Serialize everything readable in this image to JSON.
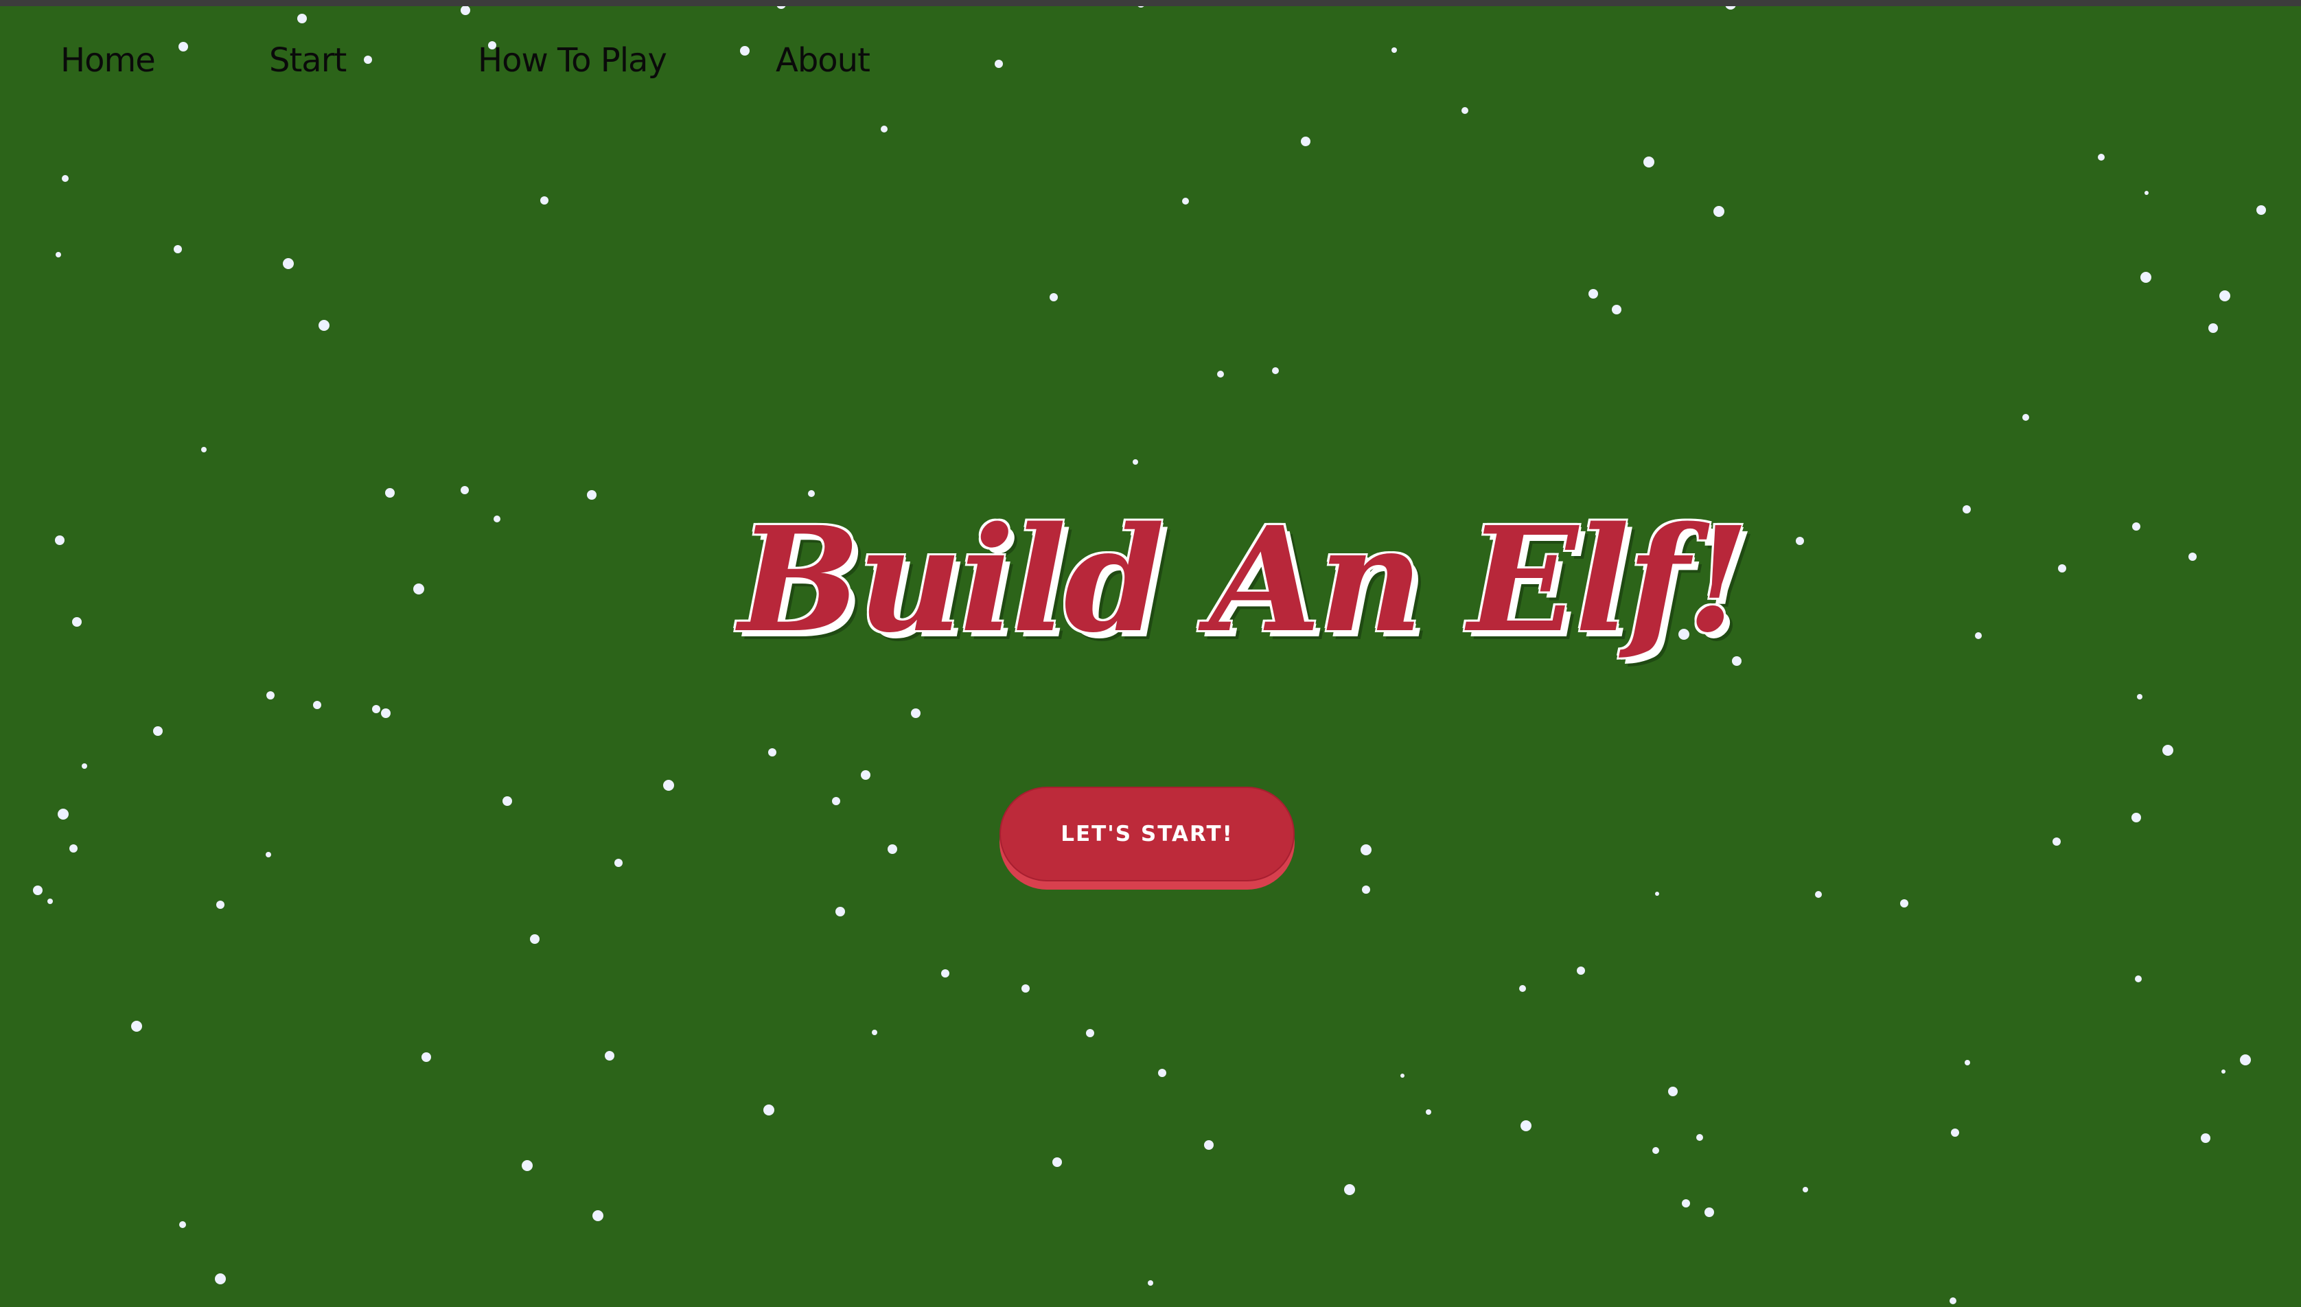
{
  "nav": {
    "items": [
      {
        "label": "Home"
      },
      {
        "label": "Start"
      },
      {
        "label": "How To Play"
      },
      {
        "label": "About"
      }
    ]
  },
  "hero": {
    "title": "Build An Elf!",
    "start_button_label": "LET'S START!"
  },
  "colors": {
    "background": "#2c6419",
    "title_red": "#b8273a",
    "button_red": "#bd2a3a",
    "snow": "#eef2ff"
  }
}
